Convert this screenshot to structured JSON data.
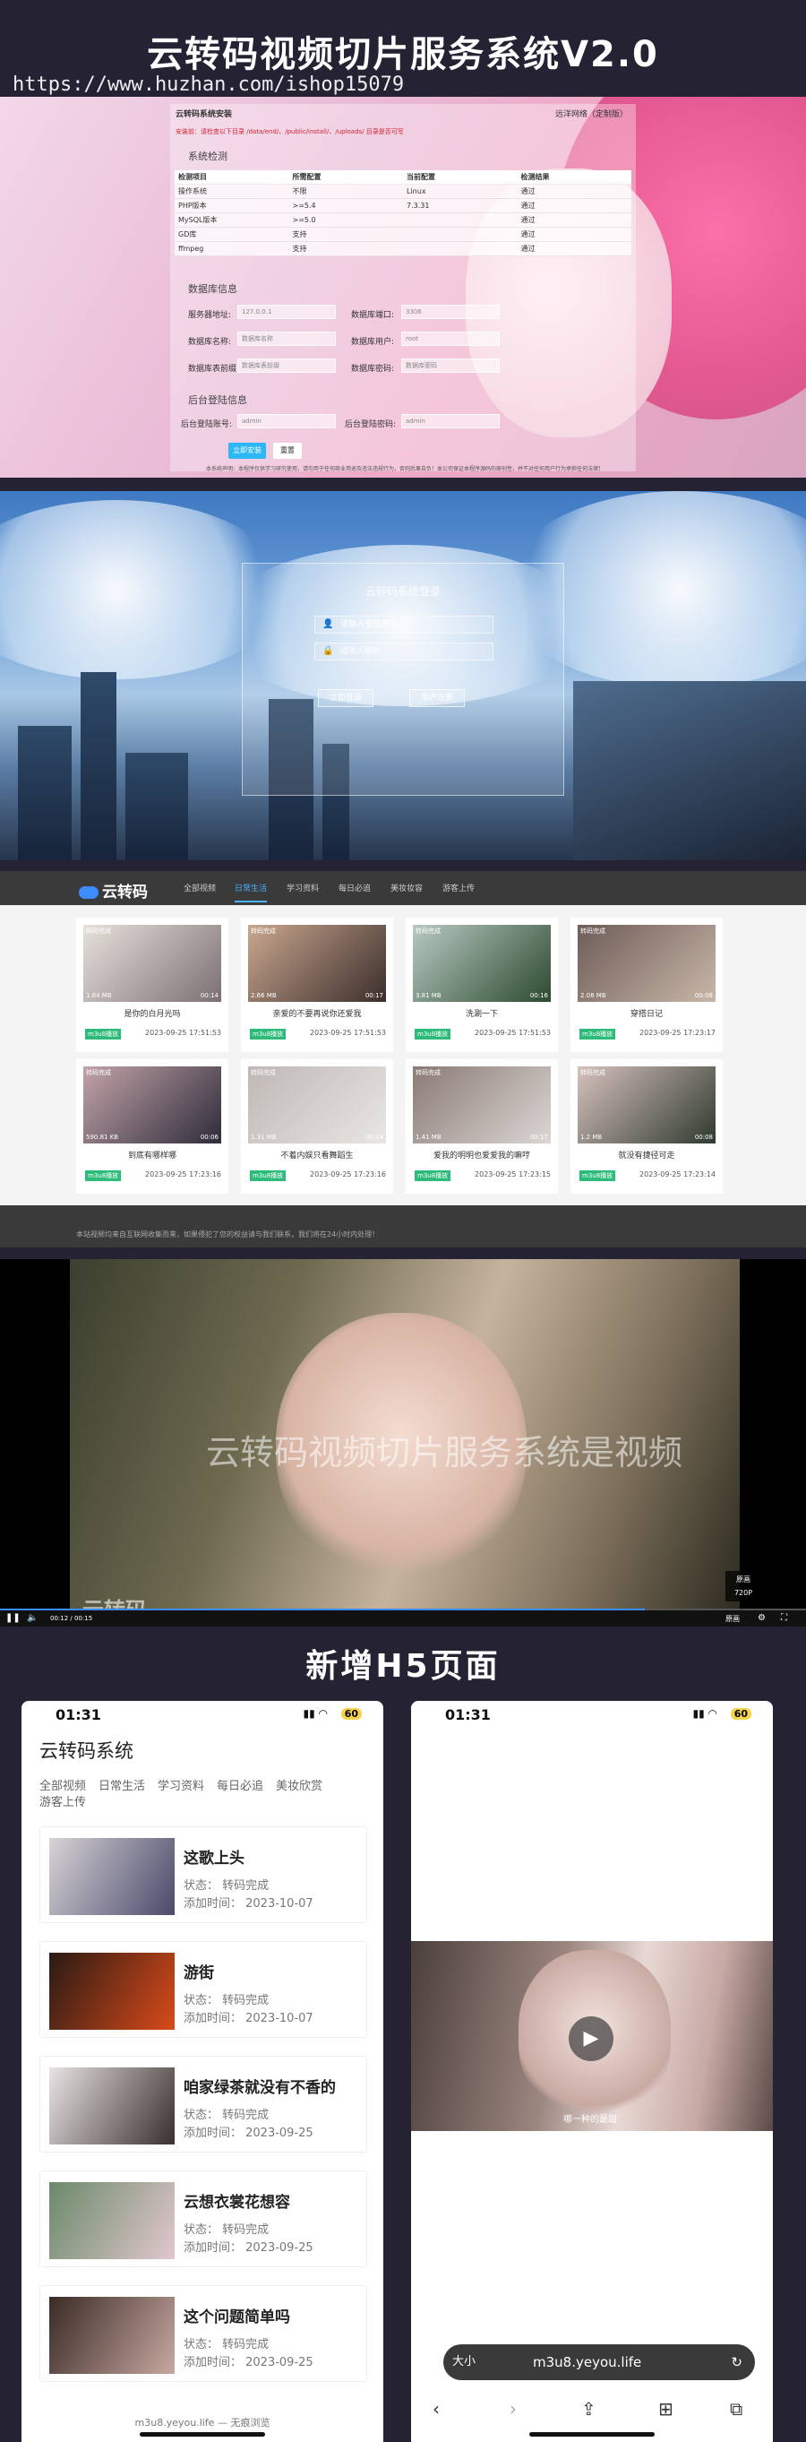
{
  "banner": {
    "title": "云转码视频切片服务系统V2.0",
    "url": "https://www.huzhan.com/ishop15079"
  },
  "install": {
    "heading": "云转码系统安装",
    "top_right": "远洋网络（定制版）",
    "warning": "安装前：请检查以下目录  /data/end/、/public/install/、/uploads/ 目录是否可写",
    "env_section": "系统检测",
    "env_headers": [
      "检测项目",
      "所需配置",
      "当前配置",
      "检测结果"
    ],
    "env_rows": [
      [
        "操作系统",
        "不限",
        "Linux",
        "通过"
      ],
      [
        "PHP版本",
        ">=5.4",
        "7.3.31",
        "通过"
      ],
      [
        "MySQL版本",
        ">=5.0",
        "",
        "通过"
      ],
      [
        "GD库",
        "支持",
        "",
        "通过"
      ],
      [
        "ffmpeg",
        "支持",
        "",
        "通过"
      ]
    ],
    "db_section": "数据库信息",
    "db_fields": [
      {
        "label": "服务器地址:",
        "value": "127.0.0.1"
      },
      {
        "label": "数据库端口:",
        "value": "3306"
      },
      {
        "label": "数据库名称:",
        "value": "数据库名称"
      },
      {
        "label": "数据库用户:",
        "value": "root"
      },
      {
        "label": "数据库表前缀:",
        "value": "数据库表前缀"
      },
      {
        "label": "数据库密码:",
        "value": "数据库密码"
      }
    ],
    "admin_section": "后台登陆信息",
    "admin_fields": [
      {
        "label": "后台登陆账号:",
        "value": "admin"
      },
      {
        "label": "后台登陆密码:",
        "value": "admin"
      }
    ],
    "install_btn": "立即安装",
    "reset_btn": "重置",
    "notice": "本系统声明：本程序仅供学习研究使用，请勿用于任何商业用途及违法违规行为，否则后果自负！本公司保证本程序源码的原创性，并不对任何用户行为承担任何法律责任。本公司拥有本系统最终解释权，如有疑问可联系客服。"
  },
  "login": {
    "title": "云转码系统登录",
    "user_placeholder": "请输入登陆账号",
    "pass_placeholder": "请输入密码",
    "login_btn": "立即登录",
    "reg_btn": "用户注册"
  },
  "weblist": {
    "logo": "云转码",
    "tabs": [
      "全部视频",
      "日常生活",
      "学习资料",
      "每日必追",
      "美妆妆容",
      "游客上传"
    ],
    "videos": [
      {
        "title": "是你的白月光吗",
        "size": "1.64 MB",
        "dur": "00:14",
        "date": "2023-09-25 17:51:53",
        "tag": "转码完成",
        "badge": "m3u8播放",
        "c1": "#7b6f72",
        "c2": "#e7e2dc"
      },
      {
        "title": "亲爱的不要再说你还爱我",
        "size": "2.66 MB",
        "dur": "00:17",
        "date": "2023-09-25 17:51:53",
        "tag": "转码完成",
        "badge": "m3u8播放",
        "c1": "#3b2e2b",
        "c2": "#c9a78f"
      },
      {
        "title": "洗涮一下",
        "size": "3.81 MB",
        "dur": "00:16",
        "date": "2023-09-25 17:51:53",
        "tag": "转码完成",
        "badge": "m3u8播放",
        "c1": "#2c4a2f",
        "c2": "#b8c9c2"
      },
      {
        "title": "穿搭日记",
        "size": "2.08 MB",
        "dur": "00:08",
        "date": "2023-09-25 17:23:17",
        "tag": "转码完成",
        "badge": "m3u8播放",
        "c1": "#c8b7a8",
        "c2": "#6e5c58"
      },
      {
        "title": "到底有哪样哪",
        "size": "590.81 KB",
        "dur": "00:06",
        "date": "2023-09-25 17:23:16",
        "tag": "转码完成",
        "badge": "m3u8播放",
        "c1": "#2e2b3a",
        "c2": "#c2a4a8"
      },
      {
        "title": "不着内娱只看舞蹈生",
        "size": "1.31 MB",
        "dur": "00:14",
        "date": "2023-09-25 17:23:16",
        "tag": "转码完成",
        "badge": "m3u8播放",
        "c1": "#e8e6e4",
        "c2": "#bfb8b5"
      },
      {
        "title": "爱我的明明也爱爱我的嘛哼",
        "size": "1.41 MB",
        "dur": "00:17",
        "date": "2023-09-25 17:23:15",
        "tag": "转码完成",
        "badge": "m3u8播放",
        "c1": "#dcd7d4",
        "c2": "#8a7a76"
      },
      {
        "title": "就没有捷径可走",
        "size": "1.2 MB",
        "dur": "00:08",
        "date": "2023-09-25 17:23:14",
        "tag": "转码完成",
        "badge": "m3u8播放",
        "c1": "#2e3a2f",
        "c2": "#d7c2bd"
      }
    ],
    "footer": "本站视频均来自互联网收集而来，如果侵犯了您的权益请与我们联系，我们将在24小时内处理！"
  },
  "player": {
    "overlay": "云转码视频切片服务系统是视频",
    "logo": "云转码",
    "time": "00:12 / 00:15",
    "progress": 0.8,
    "quality_label": "原画",
    "quality_popup": [
      "原画",
      "720P"
    ]
  },
  "h5": {
    "title": "新增H5页面",
    "time": "01:31",
    "battery": "60",
    "app_title": "云转码系统",
    "cats": [
      "全部视频",
      "日常生活",
      "学习资料",
      "每日必追",
      "美妆欣赏",
      "游客上传"
    ],
    "items": [
      {
        "name": "这歌上头",
        "status": "状态：  转码完成",
        "date": "添加时间：  2023-10-07",
        "c1": "#d7d3d6",
        "c2": "#4a4a6a"
      },
      {
        "name": "游街",
        "status": "状态：  转码完成",
        "date": "添加时间：  2023-10-07",
        "c1": "#2a1a14",
        "c2": "#d94a1a"
      },
      {
        "name": "咱家绿茶就没有不香的",
        "status": "状态：  转码完成",
        "date": "添加时间：  2023-09-25",
        "c1": "#e8e4e4",
        "c2": "#3a2e2e"
      },
      {
        "name": "云想衣裳花想容",
        "status": "状态：  转码完成",
        "date": "添加时间：  2023-09-25",
        "c1": "#6a8a6a",
        "c2": "#e2c7cd"
      },
      {
        "name": "这个问题简单吗",
        "status": "状态：  转码完成",
        "date": "添加时间：  2023-09-25",
        "c1": "#3a2a26",
        "c2": "#c7a8a0"
      }
    ],
    "url": "m3u8.yeyou.life — 无痕浏览",
    "video_caption": "哪一种的最甜",
    "addr_size": "大小",
    "addr_url": "m3u8.yeyou.life"
  }
}
